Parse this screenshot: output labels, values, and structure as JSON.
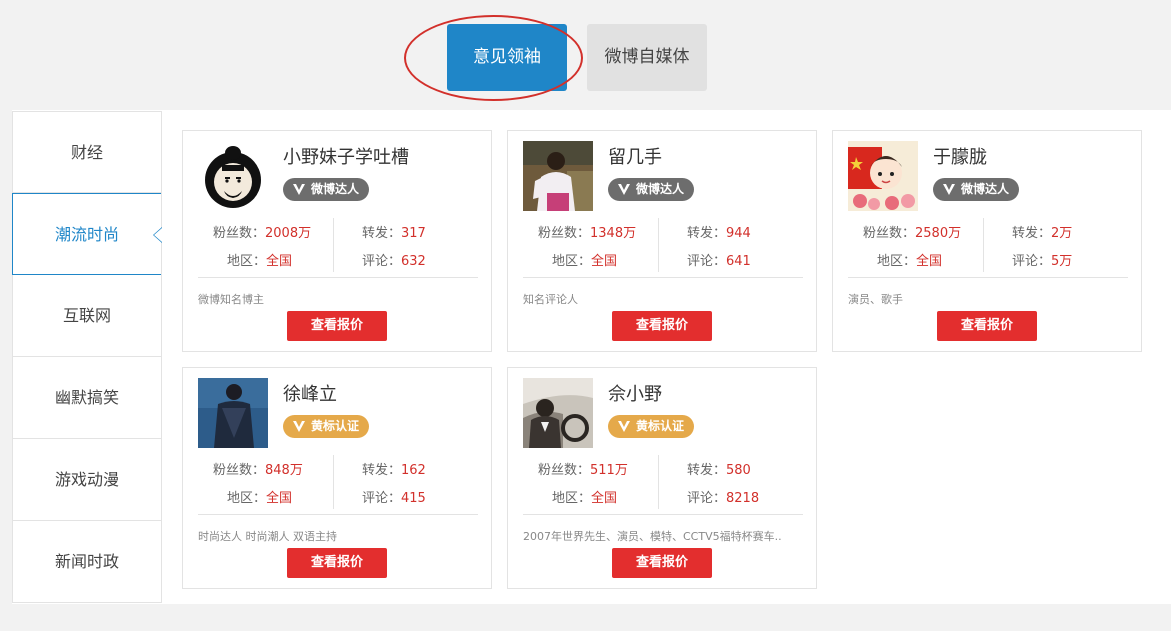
{
  "tabs": [
    {
      "label": "意见领袖",
      "active": true
    },
    {
      "label": "微博自媒体",
      "active": false
    }
  ],
  "categories": [
    {
      "label": "财经"
    },
    {
      "label": "潮流时尚",
      "active": true
    },
    {
      "label": "互联网"
    },
    {
      "label": "幽默搞笑"
    },
    {
      "label": "游戏动漫"
    },
    {
      "label": "新闻时政"
    }
  ],
  "labels": {
    "fans": "粉丝数：",
    "region": "地区：",
    "reposts": "转发：",
    "comments": "评论：",
    "quote_button": "查看报价"
  },
  "influencers": [
    {
      "name": "小野妹子学吐槽",
      "badge": "微博达人",
      "badge_type": "gray",
      "avatar_icon": "cartoon-portrait",
      "fans": "2008万",
      "region": "全国",
      "reposts": "317",
      "comments": "632",
      "description": "微博知名博主"
    },
    {
      "name": "留几手",
      "badge": "微博达人",
      "badge_type": "gray",
      "avatar_icon": "photo-man-pink",
      "fans": "1348万",
      "region": "全国",
      "reposts": "944",
      "comments": "641",
      "description": "知名评论人"
    },
    {
      "name": "于朦胧",
      "badge": "微博达人",
      "badge_type": "gray",
      "avatar_icon": "cartoon-flag",
      "fans": "2580万",
      "region": "全国",
      "reposts": "2万",
      "comments": "5万",
      "description": "演员、歌手"
    },
    {
      "name": "徐峰立",
      "badge": "黄标认证",
      "badge_type": "gold",
      "avatar_icon": "photo-man-blue",
      "fans": "848万",
      "region": "全国",
      "reposts": "162",
      "comments": "415",
      "description": "时尚达人 时尚潮人 双语主持"
    },
    {
      "name": "佘小野",
      "badge": "黄标认证",
      "badge_type": "gold",
      "avatar_icon": "photo-man-car",
      "fans": "511万",
      "region": "全国",
      "reposts": "580",
      "comments": "8218",
      "description": "2007年世界先生、演员、模特、CCTV5福特杯赛车.."
    }
  ],
  "colors": {
    "accent_blue": "#1f86c8",
    "button_red": "#e32e2e",
    "value_red": "#d2302b",
    "badge_gray": "#6d6d6d",
    "badge_gold": "#e5a94a",
    "annotation_circle": "#d2302b"
  }
}
